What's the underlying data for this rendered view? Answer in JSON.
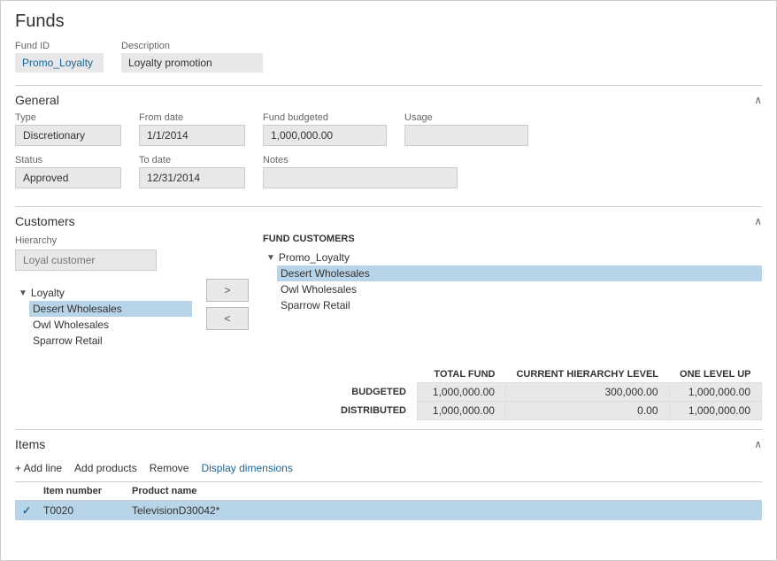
{
  "page": {
    "title": "Funds"
  },
  "fund_header": {
    "fund_id_label": "Fund ID",
    "description_label": "Description",
    "fund_id_value": "Promo_Loyalty",
    "description_value": "Loyalty promotion"
  },
  "general": {
    "section_title": "General",
    "type_label": "Type",
    "type_value": "Discretionary",
    "from_date_label": "From date",
    "from_date_value": "1/1/2014",
    "fund_budgeted_label": "Fund budgeted",
    "fund_budgeted_value": "1,000,000.00",
    "usage_label": "Usage",
    "usage_value": "",
    "status_label": "Status",
    "status_value": "Approved",
    "to_date_label": "To date",
    "to_date_value": "12/31/2014",
    "notes_label": "Notes",
    "notes_value": ""
  },
  "customers": {
    "section_title": "Customers",
    "hierarchy_label": "Hierarchy",
    "hierarchy_placeholder": "Loyal customer",
    "btn_forward": ">",
    "btn_back": "<",
    "fund_customers_label": "FUND CUSTOMERS",
    "left_tree": {
      "root_label": "Loyalty",
      "items": [
        "Desert Wholesales",
        "Owl Wholesales",
        "Sparrow Retail"
      ]
    },
    "right_tree": {
      "root_label": "Promo_Loyalty",
      "items": [
        "Desert Wholesales",
        "Owl Wholesales",
        "Sparrow Retail"
      ]
    },
    "right_selected": "Desert Wholesales",
    "left_selected": "Desert Wholesales"
  },
  "stats": {
    "col1": "TOTAL FUND",
    "col2": "CURRENT HIERARCHY LEVEL",
    "col3": "ONE LEVEL UP",
    "row1_label": "BUDGETED",
    "row1_col1": "1,000,000.00",
    "row1_col2": "300,000.00",
    "row1_col3": "1,000,000.00",
    "row2_label": "DISTRIBUTED",
    "row2_col1": "1,000,000.00",
    "row2_col2": "0.00",
    "row2_col3": "1,000,000.00"
  },
  "items": {
    "section_title": "Items",
    "btn_add_line": "+ Add line",
    "btn_add_products": "Add products",
    "btn_remove": "Remove",
    "btn_display_dimensions": "Display dimensions",
    "col_check": "✓",
    "col_item_number_label": "Item number",
    "col_product_name_label": "Product name",
    "rows": [
      {
        "checked": true,
        "item_number": "T0020",
        "product_name": "TelevisionD30042*"
      }
    ]
  }
}
